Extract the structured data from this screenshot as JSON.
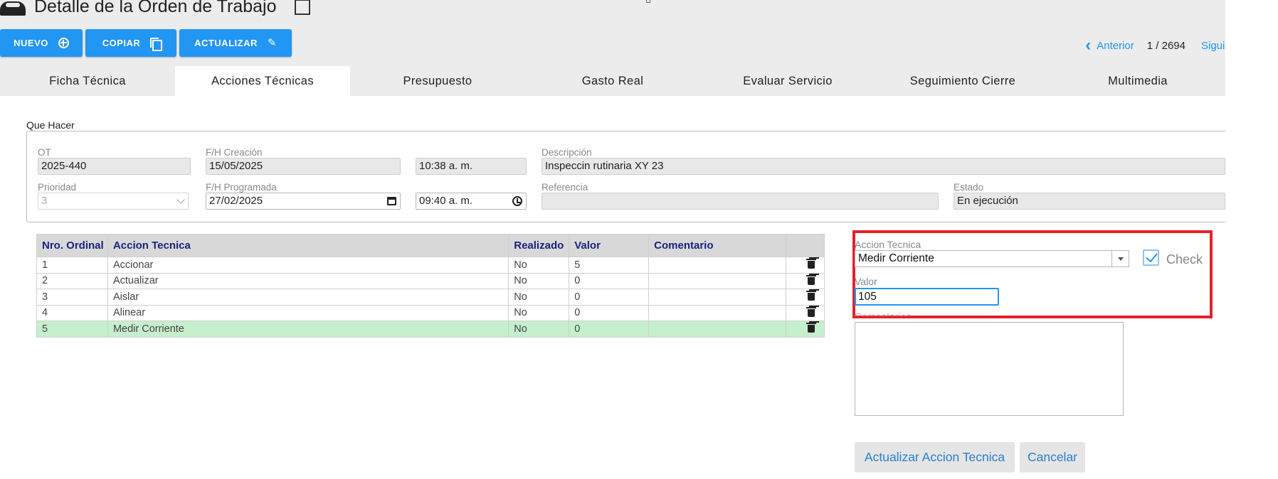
{
  "header": {
    "title": "Detalle de la Orden de Trabajo"
  },
  "toolbar": {
    "nuevo": "NUEVO",
    "copiar": "COPIAR",
    "actualizar": "ACTUALIZAR"
  },
  "pager": {
    "prev": "Anterior",
    "count": "1 / 2694",
    "next": "Siguiente"
  },
  "tabs": [
    {
      "label": "Ficha Técnica"
    },
    {
      "label": "Acciones Técnicas"
    },
    {
      "label": "Presupuesto"
    },
    {
      "label": "Gasto Real"
    },
    {
      "label": "Evaluar Servicio"
    },
    {
      "label": "Seguimiento Cierre"
    },
    {
      "label": "Multimedia"
    }
  ],
  "que_hacer": {
    "legend": "Que Hacer",
    "ot_label": "OT",
    "ot_value": "2025-440",
    "creacion_label": "F/H Creación",
    "creacion_date": "15/05/2025",
    "creacion_time": "10:38 a. m.",
    "descripcion_label": "Descripción",
    "descripcion_value": "Inspeccin rutinaria XY 23",
    "prioridad_label": "Prioridad",
    "prioridad_value": "3",
    "programada_label": "F/H Programada",
    "programada_date": "27/02/2025",
    "programada_time": "09:40 a. m.",
    "referencia_label": "Referencia",
    "referencia_value": "",
    "estado_label": "Estado",
    "estado_value": "En ejecución"
  },
  "acciones_table": {
    "headers": [
      "Nro. Ordinal",
      "Accion Tecnica",
      "Realizado",
      "Valor",
      "Comentario"
    ],
    "rows": [
      {
        "ordinal": "1",
        "accion": "Accionar",
        "realizado": "No",
        "valor": "5",
        "comentario": ""
      },
      {
        "ordinal": "2",
        "accion": "Actualizar",
        "realizado": "No",
        "valor": "0",
        "comentario": ""
      },
      {
        "ordinal": "3",
        "accion": "Aislar",
        "realizado": "No",
        "valor": "0",
        "comentario": ""
      },
      {
        "ordinal": "4",
        "accion": "Alinear",
        "realizado": "No",
        "valor": "0",
        "comentario": ""
      },
      {
        "ordinal": "5",
        "accion": "Medir Corriente",
        "realizado": "No",
        "valor": "0",
        "comentario": ""
      }
    ]
  },
  "editor": {
    "accion_label": "Accion Tecnica",
    "accion_value": "Medir Corriente",
    "check_label": "Check",
    "check_checked": true,
    "valor_label": "Valor",
    "valor_value": "105",
    "comentarios_label": "Comentarios",
    "comentarios_value": "",
    "update_button": "Actualizar Accion Tecnica",
    "cancel_button": "Cancelar"
  },
  "colors": {
    "primary": "#2196f3",
    "selected_row": "#c6efcd",
    "highlight_border": "#e32129",
    "header_text": "#1a237e"
  }
}
